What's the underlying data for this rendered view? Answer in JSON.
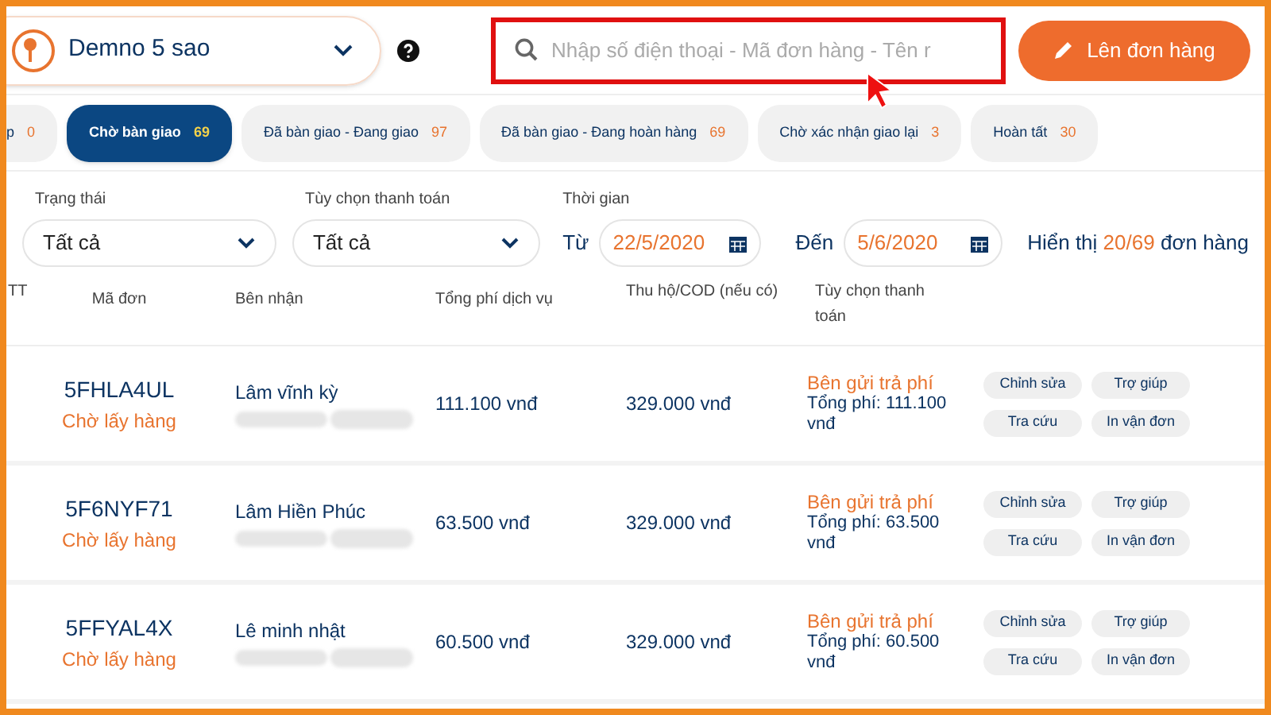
{
  "store_selector": {
    "label": "Demno 5 sao"
  },
  "search": {
    "placeholder": "Nhập số điện thoại - Mã đơn hàng - Tên r",
    "highlighted": true
  },
  "create_button": {
    "label": "Lên đơn hàng"
  },
  "tabs": [
    {
      "label": "p",
      "count": "0",
      "selected": false
    },
    {
      "label": "Chờ bàn giao",
      "count": "69",
      "selected": true
    },
    {
      "label": "Đã bàn giao - Đang giao",
      "count": "97",
      "selected": false
    },
    {
      "label": "Đã bàn giao - Đang hoàn hàng",
      "count": "69",
      "selected": false
    },
    {
      "label": "Chờ xác nhận giao lại",
      "count": "3",
      "selected": false
    },
    {
      "label": "Hoàn tất",
      "count": "30",
      "selected": false
    }
  ],
  "filters": {
    "status": {
      "label": "Trạng thái",
      "value": "Tất cả"
    },
    "payment": {
      "label": "Tùy chọn thanh toán",
      "value": "Tất cả"
    },
    "time": {
      "label": "Thời gian",
      "from_label": "Từ",
      "from": "22/5/2020",
      "to_label": "Đến",
      "to": "5/6/2020"
    }
  },
  "summary": {
    "prefix": "Hiển thị",
    "count": "20/69",
    "suffix": "đơn hàng"
  },
  "table": {
    "columns": [
      "TT",
      "Mã đơn",
      "Bên nhận",
      "Tổng phí dịch vụ",
      "Thu hộ/COD (nếu có)",
      "Tùy chọn thanh toán"
    ],
    "rows": [
      {
        "code": "5FHLA4UL",
        "status": "Chờ lấy hàng",
        "recipient": "Lâm vĩnh kỳ",
        "fee": "111.100 vnđ",
        "cod": "329.000 vnđ",
        "payer": "Bên gửi trả phí",
        "total": "Tổng phí: 111.100 vnđ",
        "actions": [
          "Chỉnh sửa",
          "Trợ giúp",
          "Tra cứu",
          "In vận đơn"
        ]
      },
      {
        "code": "5F6NYF71",
        "status": "Chờ lấy hàng",
        "recipient": "Lâm Hiền Phúc",
        "fee": "63.500 vnđ",
        "cod": "329.000 vnđ",
        "payer": "Bên gửi trả phí",
        "total": "Tổng phí: 63.500 vnđ",
        "actions": [
          "Chỉnh sửa",
          "Trợ giúp",
          "Tra cứu",
          "In vận đơn"
        ]
      },
      {
        "code": "5FFYAL4X",
        "status": "Chờ lấy hàng",
        "recipient": "Lê minh nhật",
        "fee": "60.500 vnđ",
        "cod": "329.000 vnđ",
        "payer": "Bên gửi trả phí",
        "total": "Tổng phí: 60.500 vnđ",
        "actions": [
          "Chỉnh sửa",
          "Trợ giúp",
          "Tra cứu",
          "In vận đơn"
        ]
      }
    ]
  }
}
